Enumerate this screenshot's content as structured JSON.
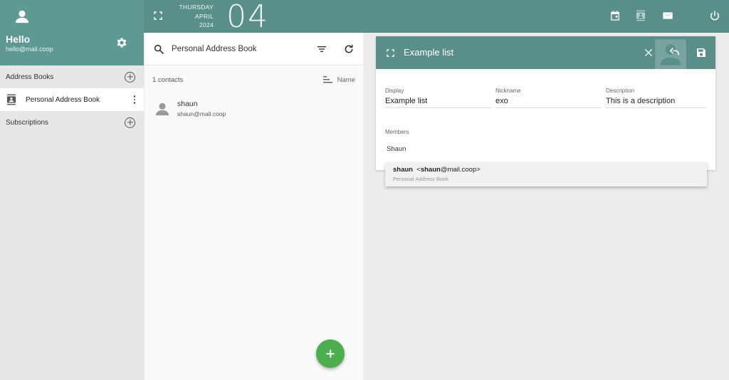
{
  "user": {
    "greeting": "Hello",
    "email": "hello@mail.coop"
  },
  "sidebar": {
    "address_books_label": "Address Books",
    "books": [
      {
        "label": "Personal Address Book"
      }
    ],
    "subscriptions_label": "Subscriptions"
  },
  "topbar": {
    "weekday": "THURSDAY",
    "month": "APRIL",
    "year": "2024",
    "day": "04"
  },
  "contacts": {
    "search_value": "Personal Address Book",
    "count_text": "1 contacts",
    "sort_label": "Name",
    "items": [
      {
        "name": "shaun",
        "email": "shaun@mail.coop"
      }
    ]
  },
  "editor": {
    "title": "Example list",
    "display_label": "Display",
    "display_value": "Example list",
    "nickname_label": "Nickname",
    "nickname_value": "exo",
    "description_label": "Description",
    "description_value": "This is a description",
    "members_label": "Members",
    "members_value": "Shaun"
  },
  "suggestion": {
    "match_bold": "shaun",
    "prefix": "<",
    "email_bold": "shaun",
    "email_rest": "@mail.coop>",
    "source": "Personal Address Book"
  },
  "colors": {
    "header_teal": "#5a8f89",
    "user_head_teal": "#5f9993",
    "fab_green": "#4cae4f",
    "sidebar_bg": "#e7e7e7"
  }
}
